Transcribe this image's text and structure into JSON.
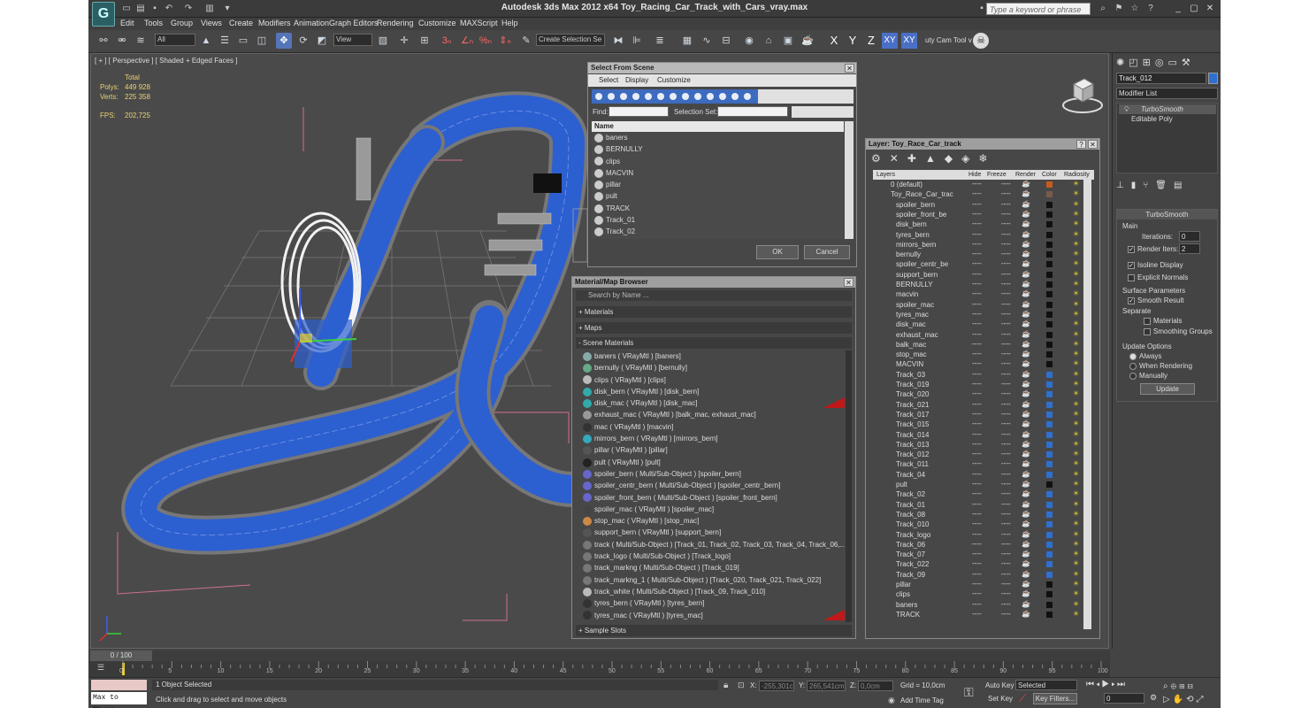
{
  "window": {
    "app_logo": "G",
    "title": "Autodesk 3ds Max  2012 x64     Toy_Racing_Car_Track_with_Cars_vray.max",
    "search_placeholder": "Type a keyword or phrase"
  },
  "menu": [
    "Edit",
    "Tools",
    "Group",
    "Views",
    "Create",
    "Modifiers",
    "Animation",
    "Graph Editors",
    "Rendering",
    "Customize",
    "MAXScript",
    "Help"
  ],
  "toolbar": {
    "filter_value": "All",
    "view_value": "View",
    "selection_set_placeholder": "Create Selection Se",
    "axes": [
      "X",
      "Y",
      "Z",
      "XY",
      "XY"
    ],
    "cam_tool": "uty Cam Tool v"
  },
  "viewport": {
    "label": "[ + ] [ Perspective ] [ Shaded + Edged Faces ]",
    "stats": {
      "total": "Total",
      "polys_label": "Polys:",
      "polys": "449 928",
      "verts_label": "Verts:",
      "verts": "225 358",
      "fps_label": "FPS:",
      "fps": "202,725"
    }
  },
  "select_from_scene": {
    "title": "Select From Scene",
    "menu": [
      "Select",
      "Display",
      "Customize"
    ],
    "find_label": "Find:",
    "selection_set_label": "Selection Set:",
    "column_name": "Name",
    "items": [
      "baners",
      "BERNULLY",
      "clips",
      "MACVIN",
      "pillar",
      "pult",
      "TRACK",
      "Track_01",
      "Track_02"
    ],
    "ok": "OK",
    "cancel": "Cancel"
  },
  "material_browser": {
    "title": "Material/Map Browser",
    "search_placeholder": "Search by Name ...",
    "sections": {
      "materials": "+ Materials",
      "maps": "+ Maps",
      "scene": "- Scene Materials",
      "sample": "+ Sample Slots"
    },
    "items": [
      "baners  ( VRayMtl ) [baners]",
      "bernully  ( VRayMtl ) [bernully]",
      "clips  ( VRayMtl ) [clips]",
      "disk_bern  ( VRayMtl ) [disk_bern]",
      "disk_mac  ( VRayMtl ) [disk_mac]",
      "exhaust_mac  ( VRayMtl ) [balk_mac, exhaust_mac]",
      "mac  ( VRayMtl ) [macvin]",
      "mirrors_bern  ( VRayMtl ) [mirrors_bern]",
      "pillar  ( VRayMtl ) [pillar]",
      "pult  ( VRayMtl ) [pult]",
      "spoiler_bern  ( Multi/Sub-Object ) [spoiler_bern]",
      "spoiler_centr_bern  ( Multi/Sub-Object ) [spoiler_centr_bern]",
      "spoiler_front_bern  ( Multi/Sub-Object ) [spoiler_front_bern]",
      "spoiler_mac  ( VRayMtl ) [spoiler_mac]",
      "stop_mac  ( VRayMtl ) [stop_mac]",
      "support_bern  ( VRayMtl ) [support_bern]",
      "track   ( Multi/Sub-Object ) [Track_01, Track_02, Track_03, Track_04, Track_06,...",
      "track_logo  ( Multi/Sub-Object ) [Track_logo]",
      "track_markng  ( Multi/Sub-Object ) [Track_019]",
      "track_markng_1  ( Multi/Sub-Object ) [Track_020, Track_021, Track_022]",
      "track_white  ( Multi/Sub-Object ) [Track_09, Track_010]",
      "tyres_bern  ( VRayMtl ) [tyres_bern]",
      "tyres_mac  ( VRayMtl ) [tyres_mac]"
    ]
  },
  "layer_manager": {
    "title": "Layer: Toy_Race_Car_track",
    "help": "?",
    "columns": [
      "Layers",
      "Hide",
      "Freeze",
      "Render",
      "Color",
      "Radiosity"
    ],
    "layers": [
      "0 (default)",
      "Toy_Race_Car_trac"
    ],
    "objects": [
      "spoiler_bern",
      "spoiler_front_be",
      "disk_bern",
      "tyres_bern",
      "mirrors_bern",
      "bernully",
      "spoiler_centr_be",
      "support_bern",
      "BERNULLY",
      "macvin",
      "spoiler_mac",
      "tyres_mac",
      "disk_mac",
      "exhaust_mac",
      "balk_mac",
      "stop_mac",
      "MACVIN",
      "Track_03",
      "Track_019",
      "Track_020",
      "Track_021",
      "Track_017",
      "Track_015",
      "Track_014",
      "Track_013",
      "Track_012",
      "Track_011",
      "Track_04",
      "pult",
      "Track_02",
      "Track_01",
      "Track_08",
      "Track_010",
      "Track_logo",
      "Track_06",
      "Track_07",
      "Track_022",
      "Track_09",
      "pillar",
      "clips",
      "baners",
      "TRACK"
    ],
    "dash": "----"
  },
  "command_panel": {
    "object_name": "Track_012",
    "modifier_list": "Modifier List",
    "stack": [
      "TurboSmooth",
      "Editable Poly"
    ],
    "turbosmooth": {
      "title": "TurboSmooth",
      "main": "Main",
      "iterations_label": "Iterations:",
      "iterations": "0",
      "render_iters_label": "Render Iters:",
      "render_iters": "2",
      "isoline": "Isoline Display",
      "explicit": "Explicit Normals",
      "surface": "Surface Parameters",
      "smooth_result": "Smooth Result",
      "separate": "Separate",
      "materials": "Materials",
      "smoothing_groups": "Smoothing Groups",
      "update_options": "Update Options",
      "always": "Always",
      "when_rendering": "When Rendering",
      "manually": "Manually",
      "update": "Update"
    }
  },
  "timeline": {
    "frame": "0 / 100",
    "ticks": [
      "0",
      "5",
      "10",
      "15",
      "20",
      "25",
      "30",
      "35",
      "40",
      "45",
      "50",
      "55",
      "60",
      "65",
      "70",
      "75",
      "80",
      "85",
      "90",
      "95",
      "100"
    ]
  },
  "status": {
    "script_box": "Max to Physc.",
    "selected": "1 Object Selected",
    "hint": "Click and drag to select and move objects",
    "x_label": "X:",
    "x": "-255,301c",
    "y_label": "Y:",
    "y": "265,541cm",
    "z_label": "Z:",
    "z": "0,0cm",
    "grid": "Grid = 10,0cm",
    "add_time_tag": "Add Time Tag",
    "auto_key": "Auto Key",
    "set_key": "Set Key",
    "selected_dd": "Selected",
    "key_filters": "Key Filters...",
    "frame_value": "0"
  }
}
